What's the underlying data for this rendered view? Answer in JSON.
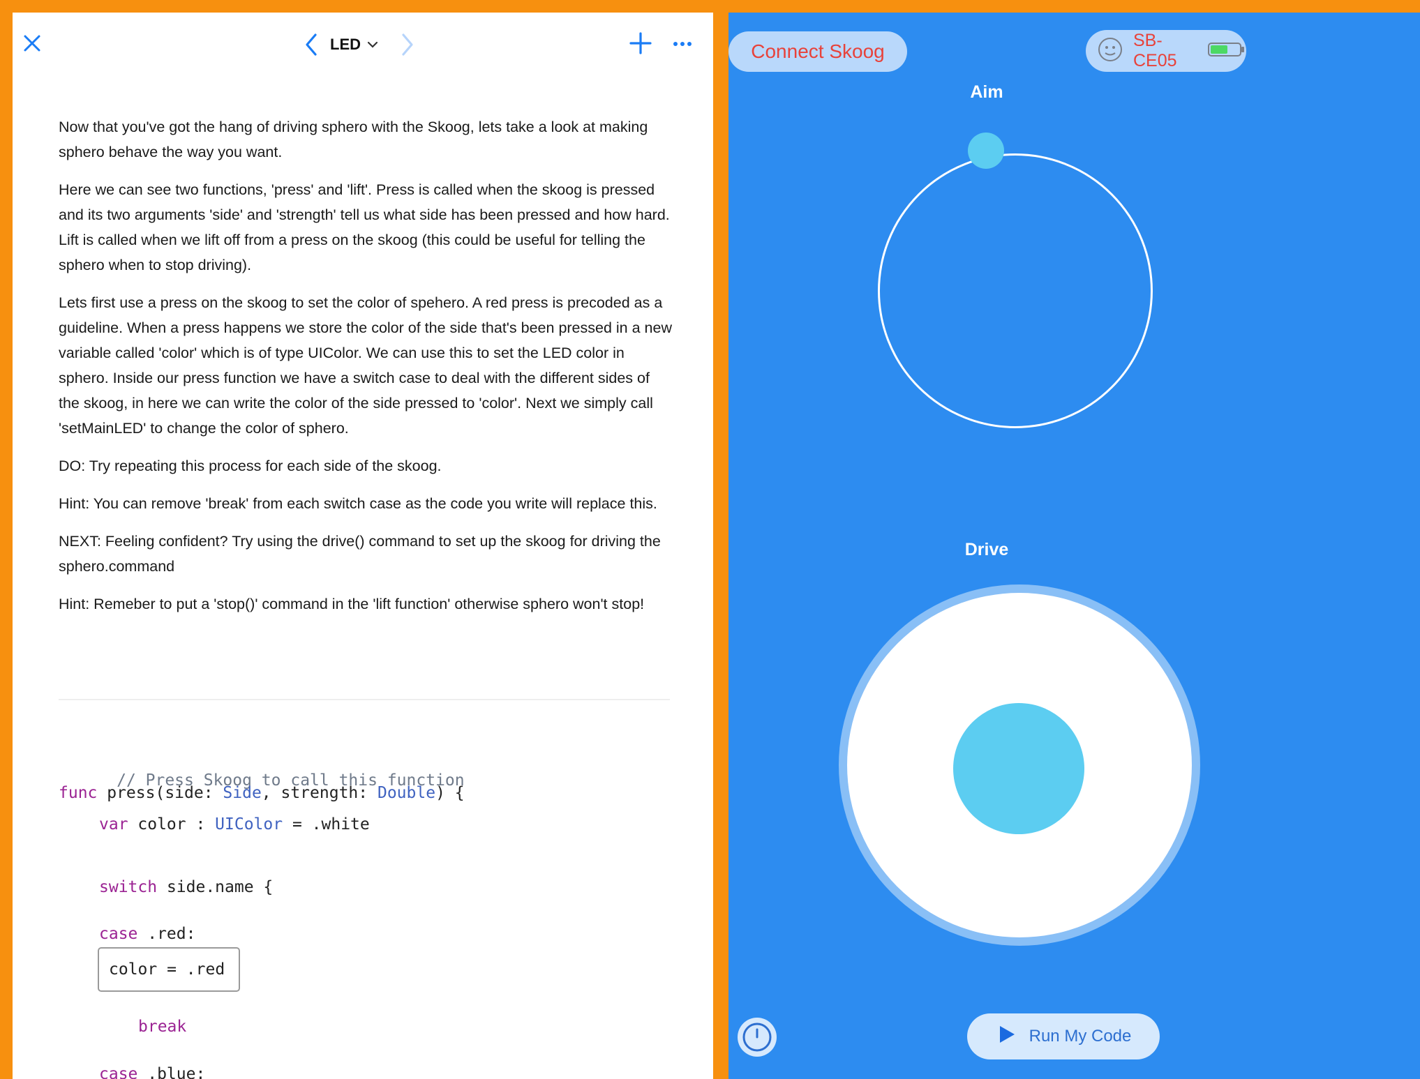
{
  "left": {
    "toolbar": {
      "title": "LED",
      "icons": [
        "close-icon",
        "chevron-left-icon",
        "chevron-down-icon",
        "chevron-right-icon",
        "plus-icon",
        "ellipsis-icon"
      ]
    },
    "prose": [
      "Now that you've got the hang of driving sphero with the Skoog, lets take a look at making sphero behave the way you want.",
      "Here we can see two functions, 'press' and 'lift'. Press is called when the skoog is pressed and its two arguments 'side' and 'strength' tell us what side has been pressed and how hard. Lift is called when we lift off from a press on the skoog (this could be useful for telling the sphero when to stop driving).",
      "Lets first use a press on the skoog to set the color of spehero. A red press is precoded as a guideline. When a press happens we store the color of the side that's been pressed in a new variable called 'color' which is of type UIColor. We can use this to set the LED color in sphero. Inside our press function we have a switch case to deal with the different sides of the skoog, in here we can write the color of the side pressed to 'color'. Next we simply call 'setMainLED' to change the color of sphero.",
      "DO: Try repeating this process for each side of the skoog.",
      "Hint: You can remove 'break' from each switch case as the code you write will replace this.",
      "NEXT: Feeling confident? Try using the drive() command to set up the skoog for driving the sphero.command",
      "Hint: Remeber to put a 'stop()' command in the 'lift function' otherwise sphero won't stop!"
    ],
    "code": {
      "comment": "// Press Skoog to call this function",
      "func_kw": "func",
      "func_sig_1": " press(side: ",
      "type_side": "Side",
      "func_sig_2": ", strength: ",
      "type_double": "Double",
      "func_sig_3": ") {",
      "var_kw": "var",
      "var_decl_1": " color : ",
      "type_uicolor": "UIColor",
      "var_decl_2": " = .white",
      "switch_kw": "switch",
      "switch_rest": " side.name {",
      "case_kw": "case",
      "case_red": " .red:",
      "box_line": "color = .red",
      "break_kw": "break",
      "case_blue": " .blue:"
    }
  },
  "right": {
    "connect_label": "Connect Skoog",
    "device_name": "SB-CE05",
    "battery_level": 0.6,
    "aim_label": "Aim",
    "drive_label": "Drive",
    "run_label": "Run My Code",
    "icons": [
      "sphero-icon",
      "battery-icon",
      "timer-icon",
      "play-icon"
    ],
    "colors": {
      "background": "#2d8cf0",
      "accent_cyan": "#5ccdf1",
      "connect_text": "#e8423a",
      "frame": "#f7900f"
    }
  }
}
